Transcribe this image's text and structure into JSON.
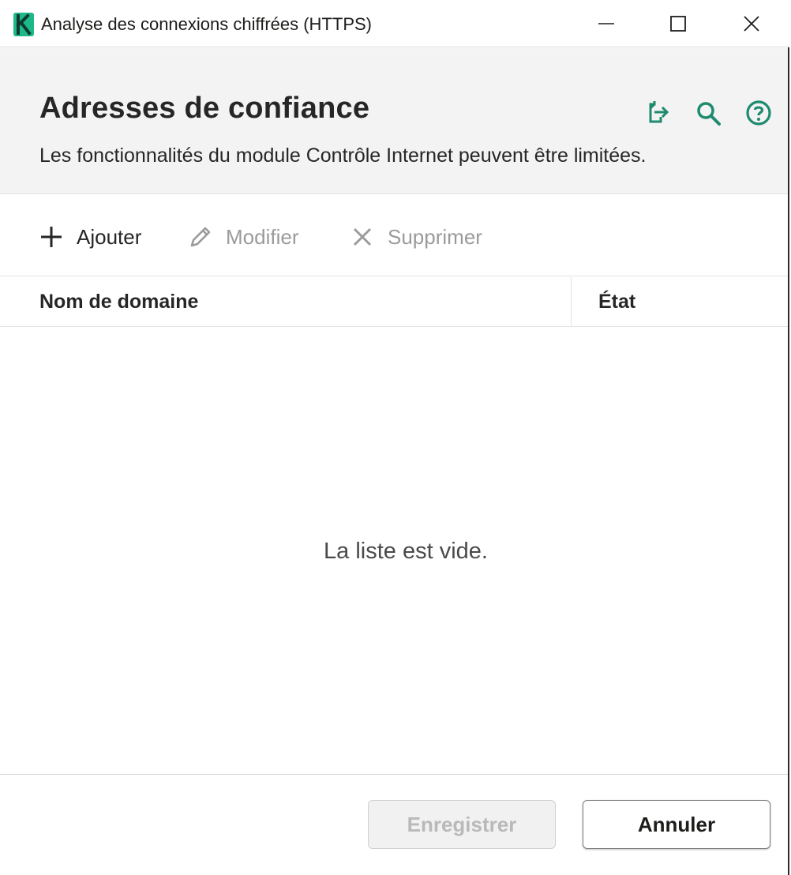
{
  "window": {
    "title": "Analyse des connexions chiffrées (HTTPS)",
    "accent_color": "#1e8a6e"
  },
  "header": {
    "title": "Adresses de confiance",
    "subtitle": "Les fonctionnalités du module Contrôle Internet peuvent être limitées.",
    "icons": [
      "export-icon",
      "search-icon",
      "help-icon"
    ]
  },
  "toolbar": {
    "add_label": "Ajouter",
    "edit_label": "Modifier",
    "delete_label": "Supprimer"
  },
  "table": {
    "columns": [
      "Nom de domaine",
      "État"
    ],
    "rows": [],
    "empty_message": "La liste est vide."
  },
  "footer": {
    "save_label": "Enregistrer",
    "cancel_label": "Annuler"
  }
}
